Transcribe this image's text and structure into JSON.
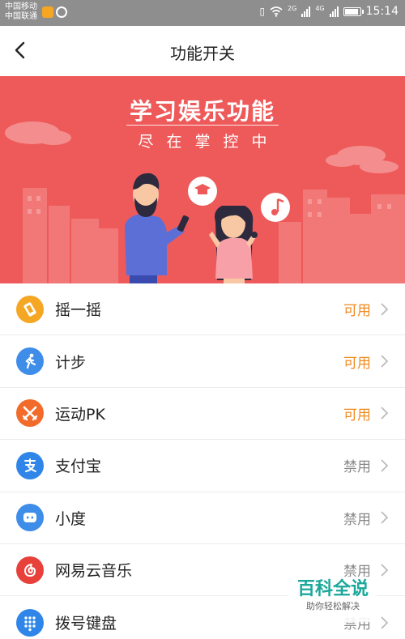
{
  "status_bar": {
    "carrier_1": "中国移动",
    "carrier_2": "中国联通",
    "net_1": "2G",
    "net_2": "4G",
    "time": "15:14"
  },
  "header": {
    "title": "功能开关"
  },
  "banner": {
    "title": "学习娱乐功能",
    "subtitle": "尽在掌控中"
  },
  "colors": {
    "accent": "#ee5a5a",
    "enabled": "#f08a1e",
    "disabled": "#888888"
  },
  "features": [
    {
      "label": "摇一摇",
      "status": "可用",
      "icon": "shake-icon"
    },
    {
      "label": "计步",
      "status": "可用",
      "icon": "pedometer-icon"
    },
    {
      "label": "运动PK",
      "status": "可用",
      "icon": "sport-pk-icon"
    },
    {
      "label": "支付宝",
      "status": "禁用",
      "icon": "alipay-icon"
    },
    {
      "label": "小度",
      "status": "禁用",
      "icon": "xiaodu-icon"
    },
    {
      "label": "网易云音乐",
      "status": "禁用",
      "icon": "netease-music-icon"
    },
    {
      "label": "拨号键盘",
      "status": "禁用",
      "icon": "dialpad-icon"
    }
  ],
  "watermark": {
    "title": "百科全说",
    "subtitle": "助你轻松解决"
  }
}
